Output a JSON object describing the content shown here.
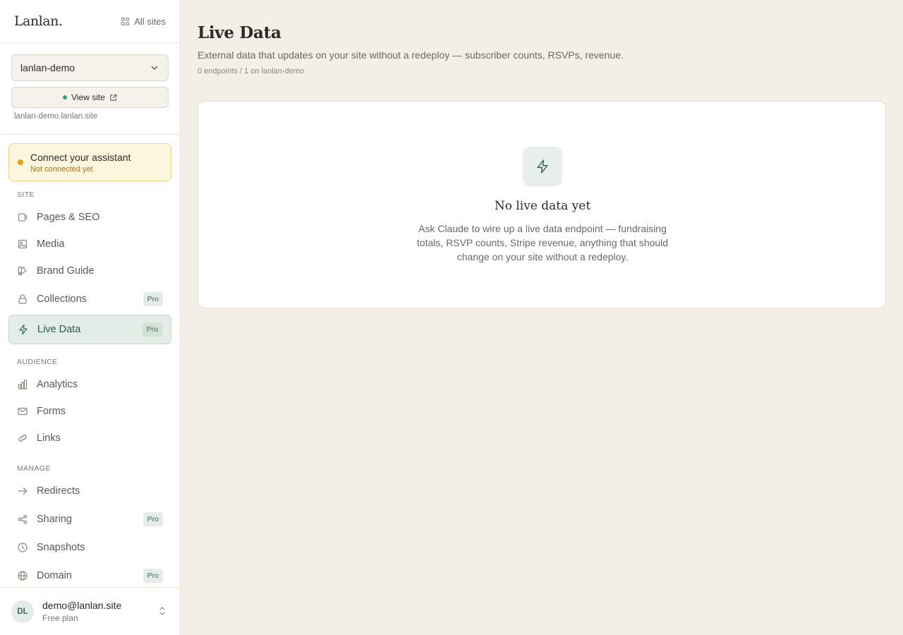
{
  "brand": {
    "logo": "Lanlan.",
    "all_sites_label": "All sites"
  },
  "site": {
    "selected": "lanlan-demo",
    "view_site_label": "View site",
    "url": "lanlan-demo.lanlan.site"
  },
  "assistant": {
    "title": "Connect your assistant",
    "status": "Not connected yet"
  },
  "nav": {
    "site_label": "SITE",
    "site_items": [
      {
        "label": "Pages & SEO"
      },
      {
        "label": "Media"
      },
      {
        "label": "Brand Guide"
      },
      {
        "label": "Collections",
        "badge": "Pro"
      },
      {
        "label": "Live Data",
        "badge": "Pro"
      }
    ],
    "audience_label": "AUDIENCE",
    "audience_items": [
      {
        "label": "Analytics"
      },
      {
        "label": "Forms"
      },
      {
        "label": "Links"
      }
    ],
    "manage_label": "MANAGE",
    "manage_items": [
      {
        "label": "Redirects"
      },
      {
        "label": "Sharing",
        "badge": "Pro"
      },
      {
        "label": "Snapshots"
      },
      {
        "label": "Domain",
        "badge": "Pro"
      }
    ]
  },
  "user": {
    "initials": "DL",
    "email": "demo@lanlan.site",
    "plan": "Free plan"
  },
  "main": {
    "title": "Live Data",
    "description": "External data that updates on your site without a redeploy — subscriber counts, RSVPs, revenue.",
    "meta": "0 endpoints / 1 on lanlan-demo",
    "empty_title": "No live data yet",
    "empty_text": "Ask Claude to wire up a live data endpoint — fundraising totals, RSVP counts, Stripe revenue, anything that should change on your site without a redeploy."
  },
  "colors": {
    "accent": "#3b6b59",
    "background": "#f3efe7",
    "warning": "#e9a20c",
    "online": "#2fa66a"
  },
  "icons": [
    "grid-icon",
    "chevron-down-icon",
    "external-link-icon",
    "page-icon",
    "image-icon",
    "brand-icon",
    "lock-icon",
    "bolt-icon",
    "bar-chart-icon",
    "mail-icon",
    "link-icon",
    "arrow-right-icon",
    "share-icon",
    "clock-icon",
    "globe-icon",
    "chevron-updown-icon"
  ]
}
